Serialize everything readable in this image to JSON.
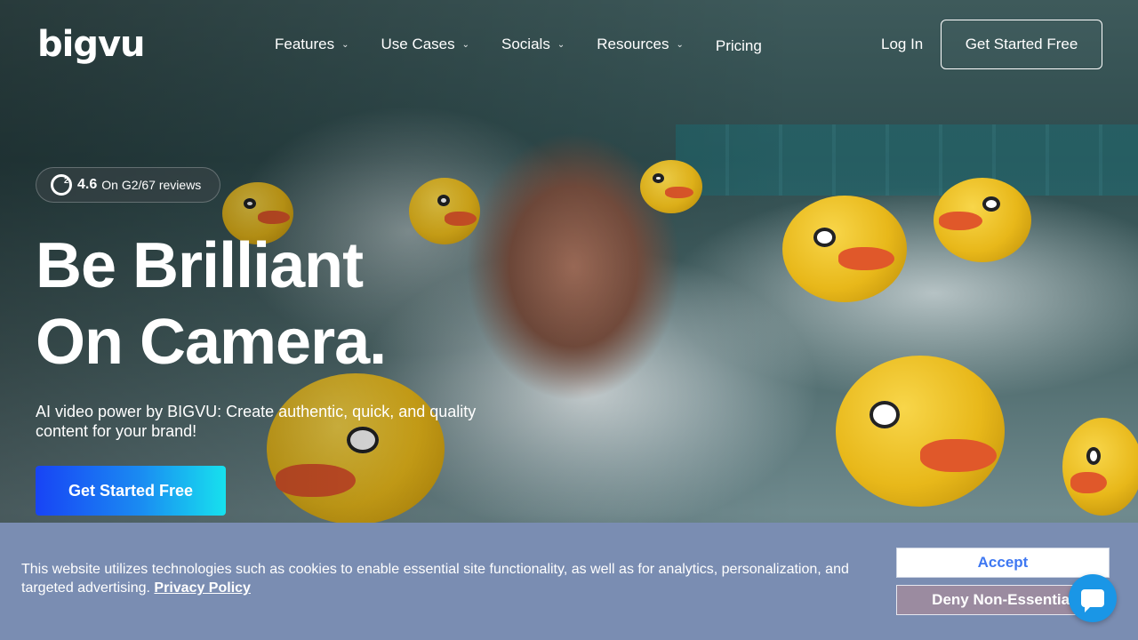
{
  "header": {
    "logo_text": "bigvu",
    "nav": [
      {
        "label": "Features",
        "has_dropdown": true
      },
      {
        "label": "Use Cases",
        "has_dropdown": true
      },
      {
        "label": "Socials",
        "has_dropdown": true
      },
      {
        "label": "Resources",
        "has_dropdown": true
      },
      {
        "label": "Pricing",
        "has_dropdown": false
      }
    ],
    "login_label": "Log In",
    "get_started_label": "Get Started Free"
  },
  "hero": {
    "rating": {
      "icon": "g2-icon",
      "score": "4.6",
      "text": "On G2/67 reviews"
    },
    "headline_line1": "Be Brilliant",
    "headline_line2": "On Camera.",
    "subtitle": "AI video power by BIGVU: Create authentic, quick, and quality content for your brand!",
    "cta_label": "Get Started Free",
    "cta_gradient": [
      "#1844f5",
      "#17e1ee"
    ]
  },
  "cookie_banner": {
    "text": "This website utilizes technologies such as cookies to enable essential site functionality, as well as for analytics, personalization, and targeted advertising.",
    "link_label": "Privacy Policy",
    "accept_label": "Accept",
    "deny_label": "Deny Non-Essential",
    "background_color": "#7a8db2",
    "accept_text_color": "#3f78f2"
  },
  "chat_widget": {
    "icon": "chat-icon",
    "color": "#1a96e6"
  }
}
